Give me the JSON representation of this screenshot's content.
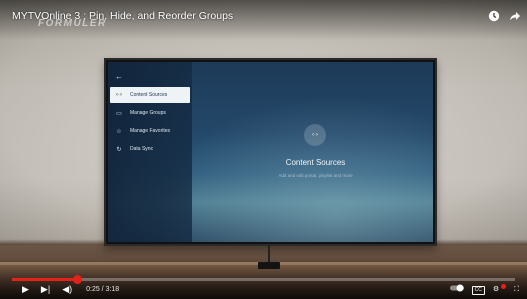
{
  "video": {
    "title": "MYTVOnline 3 : Pin, Hide, and Reorder Groups",
    "watermark": "FORMULER",
    "time_display": "0:25 / 3:18",
    "progress": 0.13
  },
  "tv_app": {
    "back_icon": "back-arrow-icon",
    "menu": [
      {
        "label": "Content Sources",
        "icon": "code-brackets-icon",
        "glyph": "‹·›",
        "active": true
      },
      {
        "label": "Manage Groups",
        "icon": "folder-icon",
        "glyph": "▭",
        "active": false
      },
      {
        "label": "Manage Favorites",
        "icon": "star-icon",
        "glyph": "☆",
        "active": false
      },
      {
        "label": "Data Sync",
        "icon": "sync-icon",
        "glyph": "↻",
        "active": false
      }
    ],
    "panel": {
      "icon_glyph": "‹·›",
      "title": "Content Sources",
      "subtitle": "Add and edit portal, playlist and more"
    }
  },
  "controls": {
    "play_glyph": "▶",
    "next_glyph": "▶|",
    "volume_glyph": "◀)",
    "cc_label": "CC",
    "settings_glyph": "⚙",
    "fullscreen_glyph": "⛶",
    "clock_glyph": "◷",
    "share_glyph": "➦",
    "accent_color": "#e62117"
  }
}
